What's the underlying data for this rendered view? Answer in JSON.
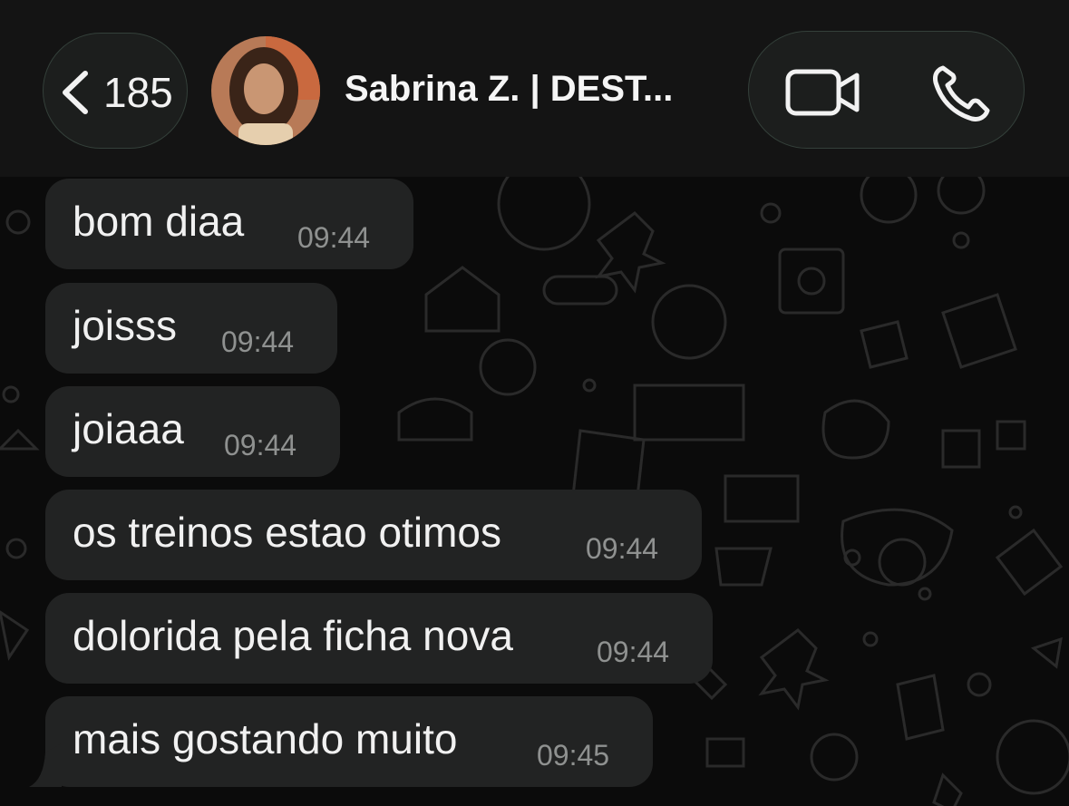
{
  "header": {
    "back_count": "185",
    "contact_name": "Sabrina Z. | DEST..."
  },
  "messages": [
    {
      "text": "bom diaa",
      "time": "09:44"
    },
    {
      "text": "joisss",
      "time": "09:44"
    },
    {
      "text": "joiaaa",
      "time": "09:44"
    },
    {
      "text": "os treinos estao otimos",
      "time": "09:44"
    },
    {
      "text": "dolorida pela ficha nova",
      "time": "09:44"
    },
    {
      "text": "mais gostando muito",
      "time": "09:45"
    }
  ],
  "colors": {
    "background": "#0b0b0b",
    "header": "#141414",
    "bubble": "#222323",
    "text": "#f1f1f1",
    "timestamp": "#8f9190"
  },
  "icons": [
    "chevron-left-icon",
    "video-camera-icon",
    "phone-icon"
  ]
}
